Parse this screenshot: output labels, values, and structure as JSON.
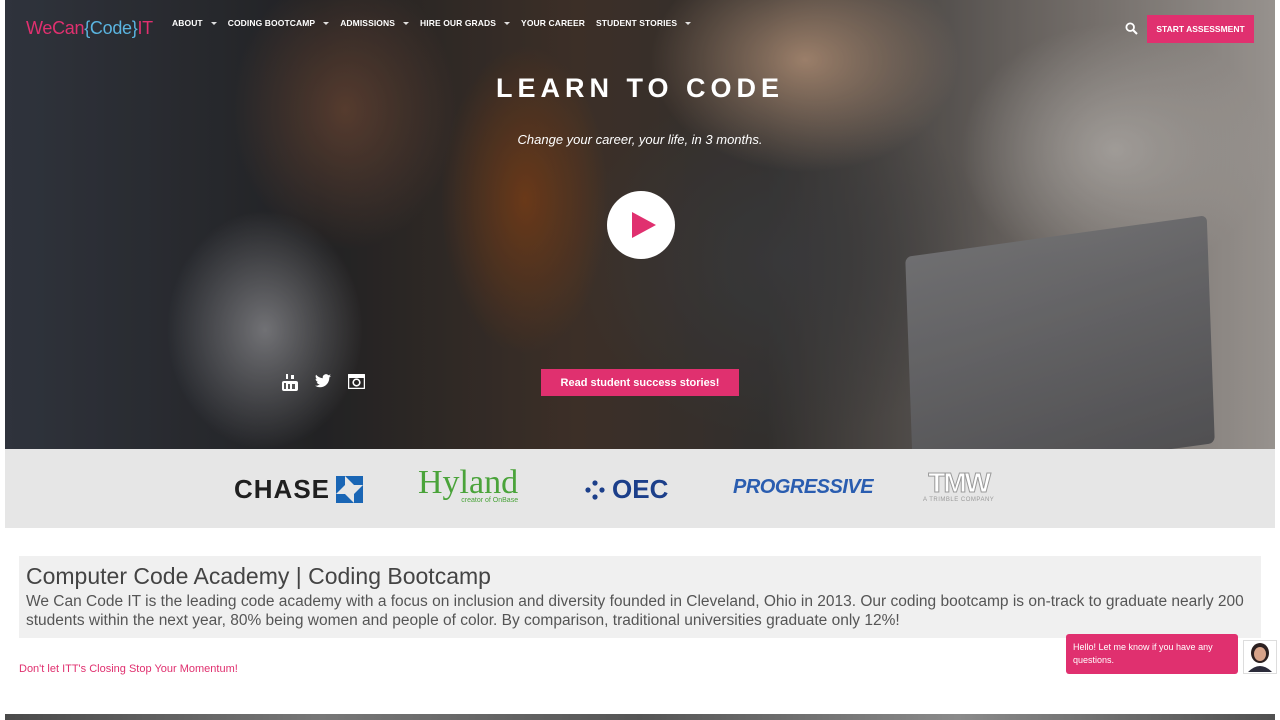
{
  "brand": {
    "logo_part1": "We",
    "logo_part2": "Can",
    "logo_part3": "{Code}",
    "logo_part4": "IT",
    "accent": "#e0306f",
    "logo_blue": "#5ab4e0"
  },
  "nav": {
    "items": [
      {
        "label": "ABOUT",
        "dropdown": true
      },
      {
        "label": "CODING BOOTCAMP",
        "dropdown": true
      },
      {
        "label": "ADMISSIONS",
        "dropdown": true
      },
      {
        "label": "HIRE OUR GRADS",
        "dropdown": true
      },
      {
        "label": "YOUR CAREER",
        "dropdown": false
      },
      {
        "label": "STUDENT STORIES",
        "dropdown": true
      }
    ],
    "search_icon": "search-icon",
    "cta_label": "START ASSESSMENT"
  },
  "hero": {
    "title": "LEARN TO CODE",
    "subtitle": "Change your career, your life, in 3 months.",
    "play_icon": "play-icon",
    "social_icons": [
      "youtube-icon",
      "twitter-icon",
      "instagram-icon"
    ],
    "stories_button": "Read student success stories!"
  },
  "partners": {
    "chase": "CHASE",
    "hyland": "Hyland",
    "hyland_tag": "creator of OnBase",
    "oec": "OEC",
    "progressive": "PROGRESSIVE",
    "tmw": "TMW",
    "tmw_tag": "A TRIMBLE COMPANY"
  },
  "intro": {
    "title": "Computer Code Academy | Coding Bootcamp",
    "text": "We Can Code IT is the leading code academy with a focus on inclusion and diversity founded in Cleveland, Ohio in 2013. Our coding bootcamp is on-track to graduate nearly 200 students within the next year, 80% being women and people of color. By comparison, traditional universities graduate only 12%!",
    "closing_link": "Don't let ITT's Closing Stop Your Momentum!"
  },
  "chat": {
    "message": "Hello! Let me know if you have any questions."
  }
}
